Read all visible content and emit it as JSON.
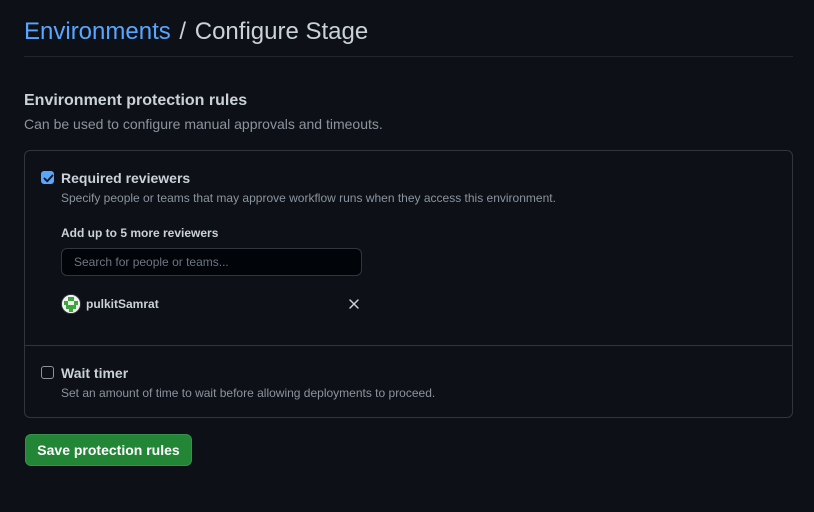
{
  "breadcrumb": {
    "link": "Environments",
    "separator": "/",
    "current": "Configure Stage"
  },
  "section": {
    "title": "Environment protection rules",
    "description": "Can be used to configure manual approvals and timeouts."
  },
  "rules": {
    "required_reviewers": {
      "checked": true,
      "label": "Required reviewers",
      "help": "Specify people or teams that may approve workflow runs when they access this environment.",
      "add_label": "Add up to 5 more reviewers",
      "search_placeholder": "Search for people or teams...",
      "search_value": "",
      "reviewers": [
        {
          "name": "pulkitSamrat",
          "avatar_icon": "identicon-avatar",
          "remove_icon": "close-icon"
        }
      ]
    },
    "wait_timer": {
      "checked": false,
      "label": "Wait timer",
      "help": "Set an amount of time to wait before allowing deployments to proceed."
    }
  },
  "save_button": {
    "label": "Save protection rules"
  },
  "colors": {
    "background": "#0d1117",
    "link": "#58a6ff",
    "primary_button": "#238636",
    "border": "#30363d",
    "muted_text": "#8b949e"
  }
}
